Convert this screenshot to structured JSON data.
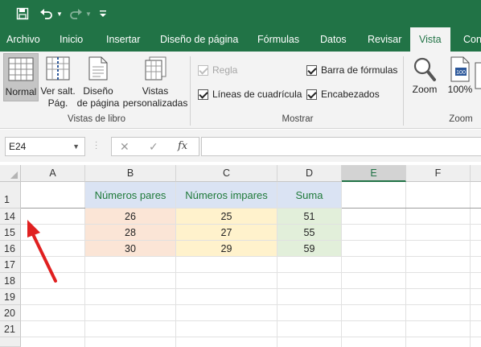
{
  "colors": {
    "brand_green": "#217346",
    "header_blue": "#dae3f3",
    "fill_orange": "#fbe5d6",
    "fill_yellow": "#fff2cc",
    "fill_green": "#e2efda",
    "arrow_red": "#e02020"
  },
  "qat": {
    "icons": [
      "save-icon",
      "undo-icon",
      "redo-icon",
      "customize-icon"
    ]
  },
  "tabs": [
    {
      "label": "Archivo"
    },
    {
      "label": "Inicio"
    },
    {
      "label": "Insertar"
    },
    {
      "label": "Diseño de página"
    },
    {
      "label": "Fórmulas"
    },
    {
      "label": "Datos"
    },
    {
      "label": "Revisar"
    },
    {
      "label": "Vista",
      "active": true
    },
    {
      "label": "Con"
    }
  ],
  "ribbon": {
    "vistas": {
      "normal": "Normal",
      "salt_l1": "Ver salt.",
      "salt_l2": "Pág.",
      "diseno_l1": "Diseño",
      "diseno_l2": "de página",
      "pers_l1": "Vistas",
      "pers_l2": "personalizadas",
      "group_label": "Vistas de libro"
    },
    "mostrar": {
      "regla": "Regla",
      "lineas": "Líneas de cuadrícula",
      "barra": "Barra de fórmulas",
      "encabezados": "Encabezados",
      "group_label": "Mostrar"
    },
    "zoom": {
      "zoom_label": "Zoom",
      "zoom100_label": "100%",
      "group_label": "Zoom"
    }
  },
  "formula_bar": {
    "name_box": "E24",
    "fx_label": "fx",
    "formula": ""
  },
  "grid": {
    "columns": [
      "A",
      "B",
      "C",
      "D",
      "E",
      "F"
    ],
    "selected_column": "E",
    "rows": [
      "1",
      "14",
      "15",
      "16",
      "17",
      "18",
      "19",
      "20",
      "21"
    ],
    "headers": {
      "B": "Números pares",
      "C": "Números impares",
      "D": "Suma"
    },
    "data": [
      {
        "B": "26",
        "C": "25",
        "D": "51"
      },
      {
        "B": "28",
        "C": "27",
        "D": "55"
      },
      {
        "B": "30",
        "C": "29",
        "D": "59"
      }
    ]
  }
}
